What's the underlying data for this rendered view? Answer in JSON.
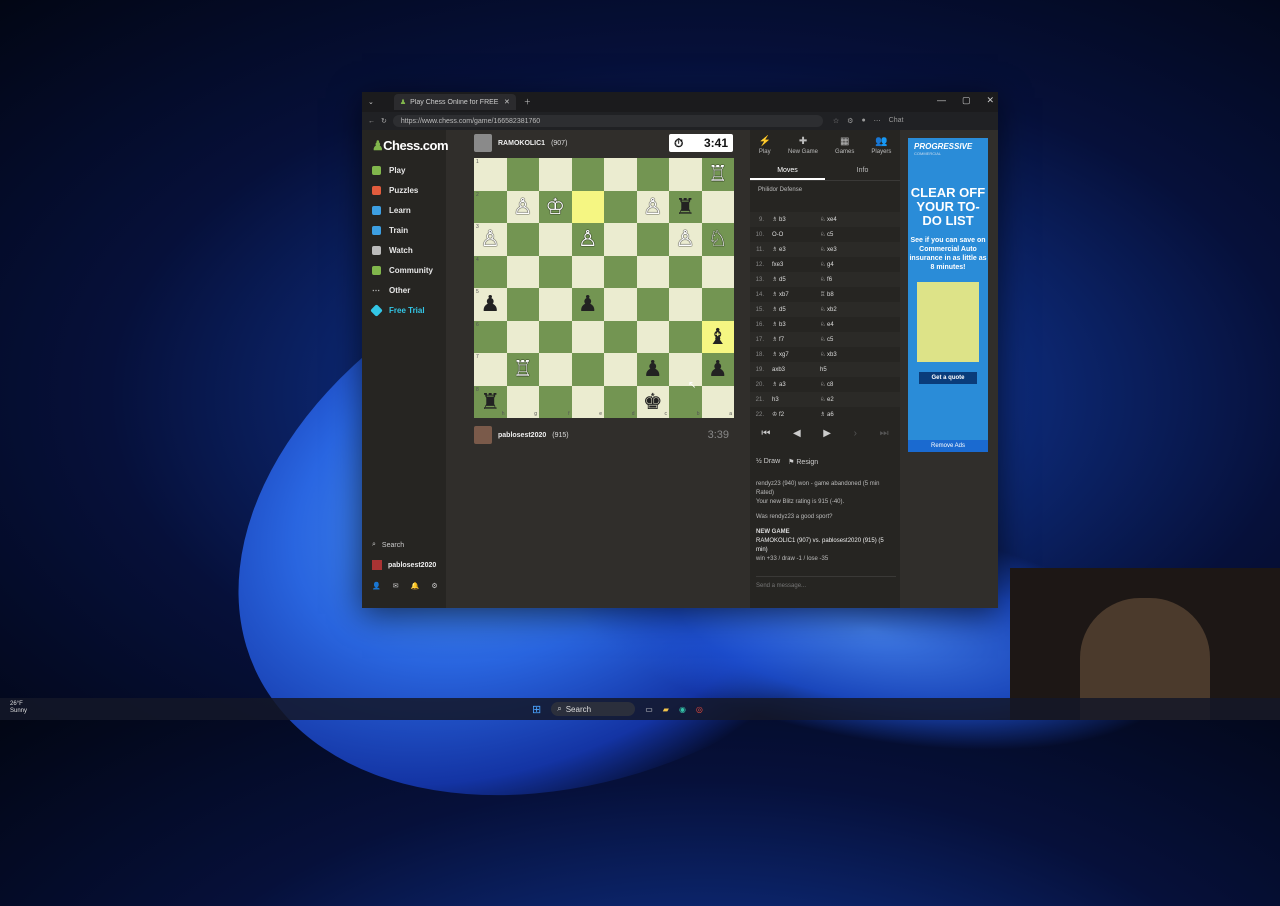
{
  "browser": {
    "tab_title": "Play Chess Online for FREE ...",
    "url": "https://www.chess.com/game/166582381760",
    "chat_label": "Chat"
  },
  "sidenav": {
    "logo": "Chess.com",
    "items": [
      {
        "label": "Play",
        "color": "#81b64c"
      },
      {
        "label": "Puzzles",
        "color": "#e25c3d"
      },
      {
        "label": "Learn",
        "color": "#3d9fe2"
      },
      {
        "label": "Train",
        "color": "#3d9fe2"
      },
      {
        "label": "Watch",
        "color": "#bbbbbb"
      },
      {
        "label": "Community",
        "color": "#81b64c"
      },
      {
        "label": "Other",
        "color": "#bbbbbb"
      },
      {
        "label": "Free Trial",
        "color": "#33c6e6"
      }
    ],
    "search": "Search",
    "username": "pablosest2020"
  },
  "top_player": {
    "name": "RAMOKOLIC1",
    "rating": "(907)",
    "clock": "3:41"
  },
  "bottom_player": {
    "name": "pablosest2020",
    "rating": "(915)",
    "clock": "3:39"
  },
  "board": {
    "ranks_left": [
      "1",
      "2",
      "3",
      "4",
      "5",
      "6",
      "7",
      "8"
    ],
    "files_bottom": [
      "h",
      "g",
      "f",
      "e",
      "d",
      "c",
      "b",
      "a"
    ],
    "highlight": [
      [
        1,
        3
      ],
      [
        5,
        7
      ]
    ],
    "pieces": [
      {
        "r": 0,
        "c": 7,
        "p": "♖",
        "side": "w"
      },
      {
        "r": 1,
        "c": 1,
        "p": "♙",
        "side": "w"
      },
      {
        "r": 1,
        "c": 2,
        "p": "♔",
        "side": "w"
      },
      {
        "r": 1,
        "c": 5,
        "p": "♙",
        "side": "w"
      },
      {
        "r": 1,
        "c": 6,
        "p": "♜",
        "side": "b"
      },
      {
        "r": 2,
        "c": 0,
        "p": "♙",
        "side": "w"
      },
      {
        "r": 2,
        "c": 3,
        "p": "♙",
        "side": "w"
      },
      {
        "r": 2,
        "c": 6,
        "p": "♙",
        "side": "w"
      },
      {
        "r": 2,
        "c": 7,
        "p": "♘",
        "side": "w"
      },
      {
        "r": 4,
        "c": 0,
        "p": "♟",
        "side": "b"
      },
      {
        "r": 4,
        "c": 3,
        "p": "♟",
        "side": "b"
      },
      {
        "r": 5,
        "c": 7,
        "p": "♝",
        "side": "b"
      },
      {
        "r": 6,
        "c": 1,
        "p": "♖",
        "side": "w"
      },
      {
        "r": 6,
        "c": 5,
        "p": "♟",
        "side": "b"
      },
      {
        "r": 6,
        "c": 7,
        "p": "♟",
        "side": "b"
      },
      {
        "r": 7,
        "c": 0,
        "p": "♜",
        "side": "b"
      },
      {
        "r": 7,
        "c": 5,
        "p": "♚",
        "side": "b"
      }
    ]
  },
  "panel": {
    "tabs": [
      {
        "icon": "⚡",
        "label": "Play"
      },
      {
        "icon": "✚",
        "label": "New Game"
      },
      {
        "icon": "▦",
        "label": "Games"
      },
      {
        "icon": "👥",
        "label": "Players"
      }
    ],
    "move_tabs": [
      "Moves",
      "Info"
    ],
    "opening": "Philidor Defense",
    "moves": [
      {
        "n": "9.",
        "w": "♗ b3",
        "b": "♘ xe4"
      },
      {
        "n": "10.",
        "w": "O-O",
        "b": "♘ c5"
      },
      {
        "n": "11.",
        "w": "♗ e3",
        "b": "♘ xe3"
      },
      {
        "n": "12.",
        "w": "fxe3",
        "b": "♘ g4"
      },
      {
        "n": "13.",
        "w": "♗ d5",
        "b": "♘ f6"
      },
      {
        "n": "14.",
        "w": "♗ xb7",
        "b": "♖ b8"
      },
      {
        "n": "15.",
        "w": "♗ d5",
        "b": "♘ xb2"
      },
      {
        "n": "16.",
        "w": "♗ b3",
        "b": "♘ e4"
      },
      {
        "n": "17.",
        "w": "♗ f7",
        "b": "♘ c5"
      },
      {
        "n": "18.",
        "w": "♗ xg7",
        "b": "♘ xb3"
      },
      {
        "n": "19.",
        "w": "axb3",
        "b": "h5"
      },
      {
        "n": "20.",
        "w": "♗ a3",
        "b": "♘ c8"
      },
      {
        "n": "21.",
        "w": "h3",
        "b": "♘ e2"
      },
      {
        "n": "22.",
        "w": "♔ f2",
        "b": "♗ a6"
      }
    ],
    "draw": "Draw",
    "resign": "Resign",
    "chat": {
      "result": "rendyz23 (940) won - game abandoned (5 min Rated)",
      "rating": "Your new Blitz rating is 915 (-40).",
      "sport": "Was rendyz23 a good sport?",
      "newgame": "NEW GAME",
      "match": "RAMOKOLIC1 (907) vs. pablosest2020 (915) (5 min)",
      "odds": "win +33 / draw -1 / lose -35"
    },
    "send_placeholder": "Send a message..."
  },
  "ad": {
    "brand": "PROGRESSIVE",
    "brand_sub": "COMMERCIAL",
    "headline": "CLEAR OFF YOUR TO-DO LIST",
    "body": "See if you can save on Commercial Auto insurance in as little as 8 minutes!",
    "cta": "Get a quote",
    "remove": "Remove Ads"
  },
  "taskbar": {
    "search": "Search",
    "weather_temp": "26°F",
    "weather_desc": "Sunny"
  }
}
